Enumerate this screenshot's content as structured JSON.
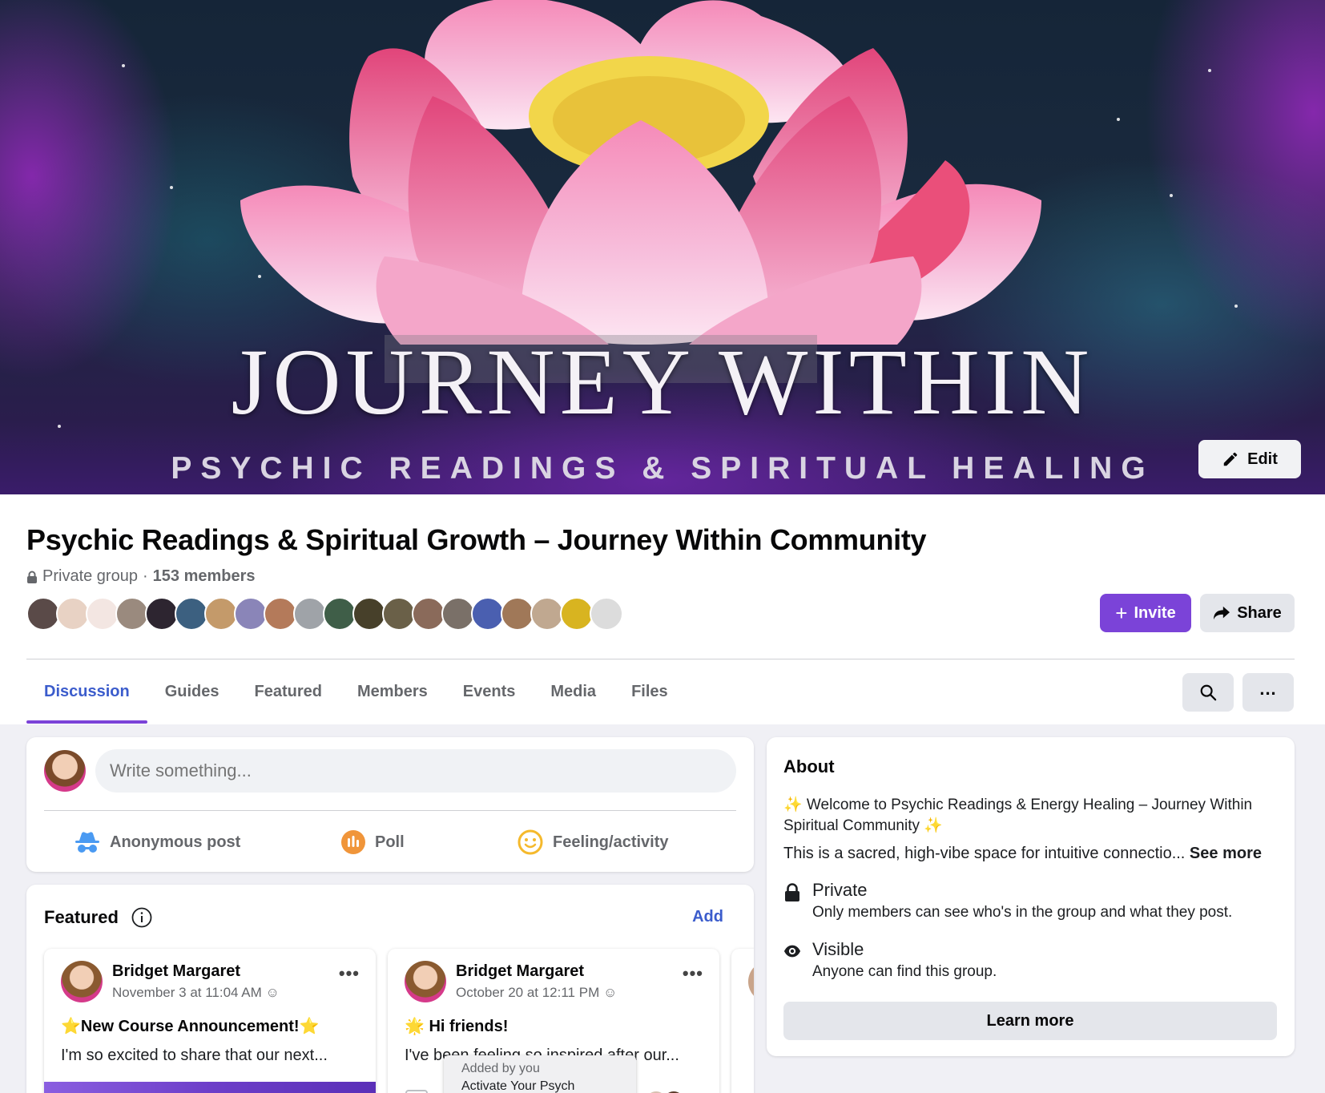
{
  "cover": {
    "title": "JOURNEY WITHIN",
    "subtitle": "PSYCHIC READINGS & SPIRITUAL HEALING",
    "edit_label": "Edit"
  },
  "group": {
    "name": "Psychic Readings & Spiritual Growth – Journey Within Community",
    "privacy": "Private group",
    "separator": "·",
    "members": "153 members",
    "invite_label": "Invite",
    "share_label": "Share",
    "avatar_colors": [
      "#5a4a48",
      "#e8d2c4",
      "#f3e6e2",
      "#9a8a7e",
      "#2d2530",
      "#3c6080",
      "#c49a6a",
      "#8a85b8",
      "#b47a5a",
      "#9fa3a8",
      "#3f5e48",
      "#47402a",
      "#6a6048",
      "#8a6a5a",
      "#7a7068",
      "#4a5fb0",
      "#a07858",
      "#c0a890",
      "#d8b420",
      "#dcdcdc"
    ]
  },
  "tabs": [
    "Discussion",
    "Guides",
    "Featured",
    "Members",
    "Events",
    "Media",
    "Files"
  ],
  "composer": {
    "placeholder": "Write something...",
    "actions": {
      "anonymous": "Anonymous post",
      "poll": "Poll",
      "feeling": "Feeling/activity"
    }
  },
  "featured": {
    "title": "Featured",
    "add_label": "Add",
    "posts": [
      {
        "author": "Bridget Margaret",
        "time": "November 3 at 11:04 AM",
        "title": "⭐New Course Announcement!⭐",
        "text": "I'm so excited to share that our next..."
      },
      {
        "author": "Bridget Margaret",
        "time": "October 20 at 12:11 PM",
        "title": "🌟 Hi friends!",
        "text": "I've been feeling so inspired after our..."
      }
    ],
    "tooltip": {
      "line1": "Added by you",
      "line2": "Activate Your Psych"
    }
  },
  "about": {
    "title": "About",
    "description": "✨ Welcome to Psychic Readings & Energy Healing – Journey Within Spiritual Community ✨",
    "description2": "This is a sacred, high-vibe space for intuitive connectio...",
    "see_more": "See more",
    "private_title": "Private",
    "private_text": "Only members can see who's in the group and what they post.",
    "visible_title": "Visible",
    "visible_text": "Anyone can find this group.",
    "learn_more": "Learn more"
  },
  "colors": {
    "accent": "#7b43d8",
    "link": "#3b5ccc"
  }
}
